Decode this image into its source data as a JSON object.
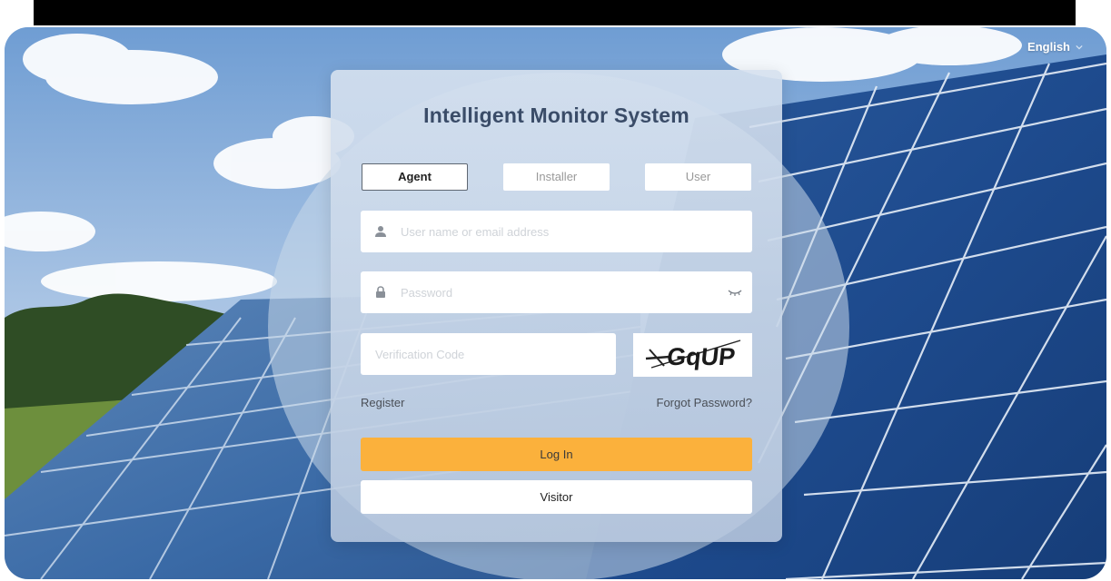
{
  "header": {
    "language": "English"
  },
  "login": {
    "title": "Intelligent Monitor System",
    "roles": [
      "Agent",
      "Installer",
      "User"
    ],
    "active_role": "Agent",
    "username_placeholder": "User name or email address",
    "username_value": "",
    "password_placeholder": "Password",
    "password_value": "",
    "captcha_placeholder": "Verification Code",
    "captcha_value": "",
    "captcha_text": "GqUP",
    "register_label": "Register",
    "forgot_label": "Forgot Password?",
    "login_label": "Log In",
    "visitor_label": "Visitor"
  },
  "icons": {
    "user_field": "user-icon",
    "password_field": "lock-icon",
    "password_toggle": "eye-closed-icon",
    "language_dropdown": "chevron-down-icon"
  },
  "colors": {
    "accent": "#fbb13c",
    "title": "#3a4c68",
    "active_border": "#5e6772"
  }
}
